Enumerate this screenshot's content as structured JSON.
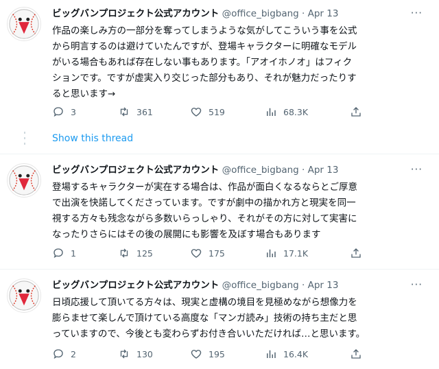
{
  "tweets": [
    {
      "name": "ビッグバンプロジェクト公式アカウント",
      "handle": "@office_bigbang",
      "date": "· Apr 13",
      "more": "···",
      "lines": [
        "作品の楽しみ方の一部分を奪ってしまうような気がしてこういう事を公式",
        "から明言するのは避けていたんですが、登場キャラクターに明確なモデル",
        "がいる場合もあれば存在しない事もあります。「アオイホノオ」はフィク",
        "ションです。ですが虚実入り交じった部分もあり、それが魅力だったりす",
        "ると思います→"
      ],
      "replies": "3",
      "retweets": "361",
      "likes": "519",
      "views": "68.3K"
    },
    {
      "name": "ビッグバンプロジェクト公式アカウント",
      "handle": "@office_bigbang",
      "date": "· Apr 13",
      "more": "···",
      "lines": [
        "登場するキャラクターが実在する場合は、作品が面白くなるならとご厚意",
        "で出演を快諾してくださっています。ですが劇中の描かれ方と現実を同一",
        "視する方々も残念ながら多数いらっしゃり、それがその方に対して実害に",
        "なったりさらにはその後の展開にも影響を及ぼす場合もあります"
      ],
      "replies": "1",
      "retweets": "125",
      "likes": "175",
      "views": "17.1K"
    },
    {
      "name": "ビッグバンプロジェクト公式アカウント",
      "handle": "@office_bigbang",
      "date": "· Apr 13",
      "more": "···",
      "lines": [
        "日頃応援して頂いてる方々は、現実と虚構の境目を見極めながら想像力を",
        "膨らませて楽しんで頂けている高度な「マンガ読み」技術の持ち主だと思",
        "っていますので、今後とも変わらずお付き合いいただければ…と思います。"
      ],
      "replies": "2",
      "retweets": "130",
      "likes": "195",
      "views": "16.4K"
    }
  ],
  "show_thread": "Show this thread",
  "colors": {
    "link": "#1d9bf0",
    "text": "#0f1419",
    "muted": "#536471",
    "accent": "#e0283c"
  }
}
